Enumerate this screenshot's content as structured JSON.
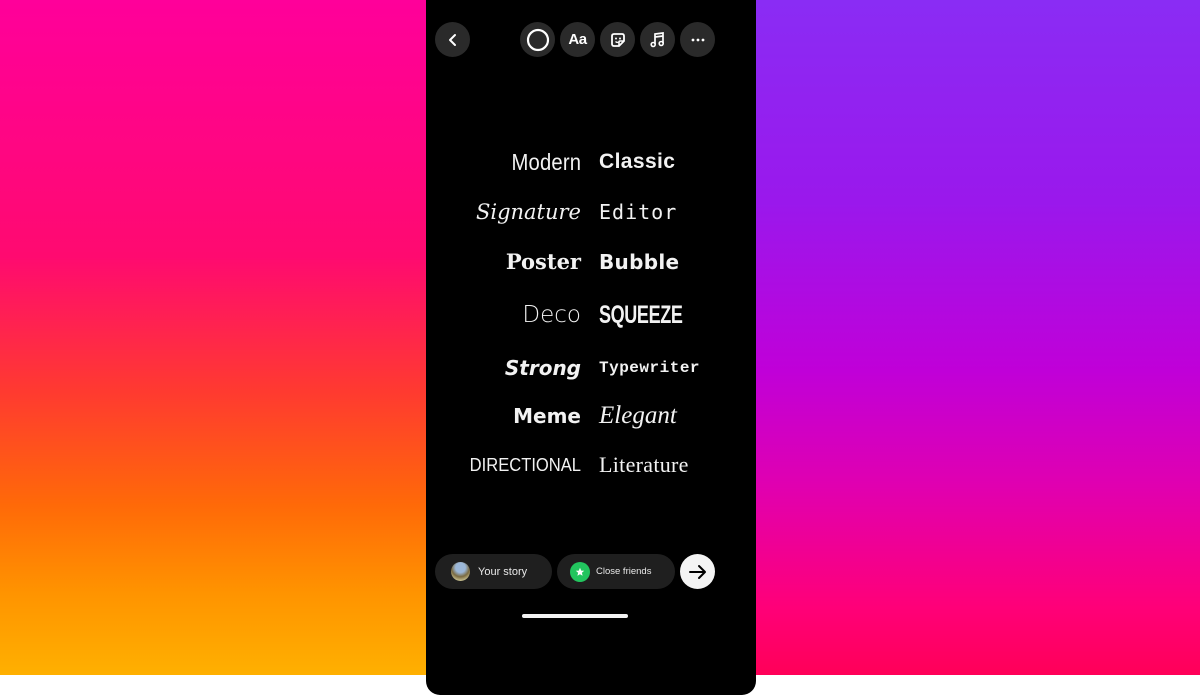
{
  "background": {
    "left_colors": [
      "#ff009a",
      "#ff0a70",
      "#ff3a30",
      "#ff6a08",
      "#ffb000"
    ],
    "right_colors": [
      "#8a2cf4",
      "#9a18ec",
      "#c000d8",
      "#e000b0",
      "#ff0058"
    ]
  },
  "toolbar": {
    "back_icon": "chevron-left-icon",
    "tools": [
      {
        "name": "color-circle",
        "icon": "circle-icon"
      },
      {
        "name": "text-style",
        "label": "Aa"
      },
      {
        "name": "sticker",
        "icon": "sticker-icon"
      },
      {
        "name": "music",
        "icon": "music-note-icon"
      },
      {
        "name": "more",
        "icon": "more-horizontal-icon"
      }
    ]
  },
  "fonts": [
    {
      "left": "Modern",
      "right": "Classic"
    },
    {
      "left": "Signature",
      "right": "Editor"
    },
    {
      "left": "Poster",
      "right": "Bubble"
    },
    {
      "left": "Deco",
      "right": "SQUEEZE"
    },
    {
      "left": "Strong",
      "right": "Typewriter"
    },
    {
      "left": "Meme",
      "right": "Elegant"
    },
    {
      "left": "DIRECTIONAL",
      "right": "Literature"
    }
  ],
  "share": {
    "your_story_label": "Your story",
    "close_friends_label": "Close friends",
    "close_friends_color": "#22c55e",
    "send_icon": "arrow-right-icon"
  }
}
